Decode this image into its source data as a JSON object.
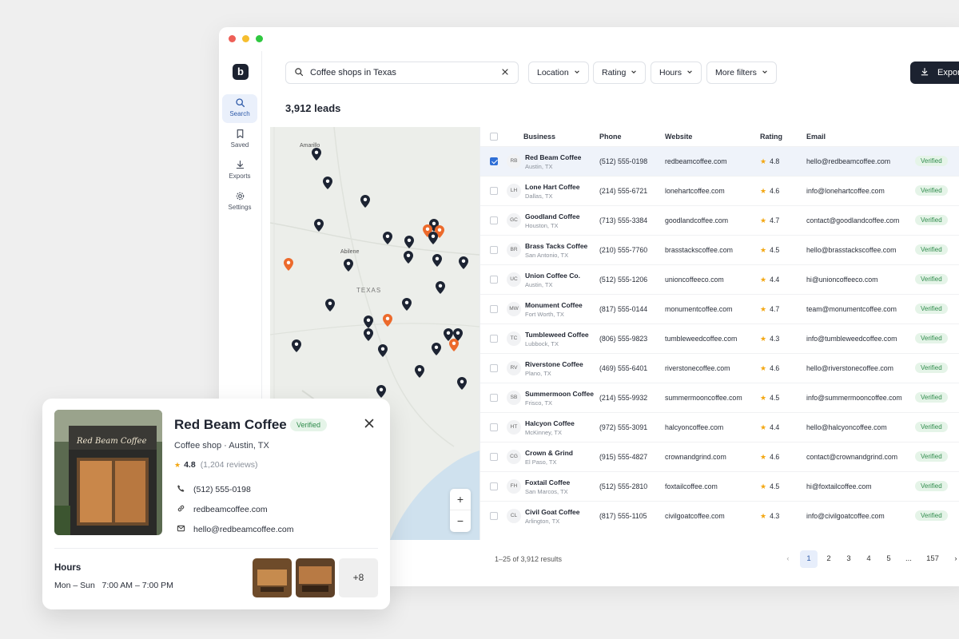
{
  "sidebar": {
    "logo": "b",
    "items": [
      {
        "label": "Search",
        "icon": "search-icon"
      },
      {
        "label": "Saved",
        "icon": "bookmark-icon"
      },
      {
        "label": "Exports",
        "icon": "download-icon"
      },
      {
        "label": "Settings",
        "icon": "gear-icon"
      }
    ]
  },
  "search": {
    "query": "Coffee shops in Texas"
  },
  "filters": [
    "Location",
    "Rating",
    "Hours",
    "More filters"
  ],
  "export_label": "Export",
  "leads_count": "3,912 leads",
  "map": {
    "labels": [
      "Amarillo",
      "Abilene",
      "TEXAS"
    ],
    "zoom_in": "+",
    "zoom_out": "−"
  },
  "table": {
    "headers": [
      "Business",
      "Phone",
      "Website",
      "Rating",
      "Email"
    ],
    "rows": [
      {
        "initials": "RB",
        "name": "Red Beam Coffee",
        "city": "Austin, TX",
        "phone": "(512) 555-0198",
        "website": "redbeamcoffee.com",
        "rating": "4.8",
        "email": "hello@redbeamcoffee.com",
        "status": "Verified",
        "selected": true
      },
      {
        "initials": "LH",
        "name": "Lone Hart Coffee",
        "city": "Dallas, TX",
        "phone": "(214) 555-6721",
        "website": "lonehartcoffee.com",
        "rating": "4.6",
        "email": "info@lonehartcoffee.com",
        "status": "Verified",
        "selected": false
      },
      {
        "initials": "GC",
        "name": "Goodland Coffee",
        "city": "Houston, TX",
        "phone": "(713) 555-3384",
        "website": "goodlandcoffee.com",
        "rating": "4.7",
        "email": "contact@goodlandcoffee.com",
        "status": "Verified",
        "selected": false
      },
      {
        "initials": "BR",
        "name": "Brass Tacks Coffee",
        "city": "San Antonio, TX",
        "phone": "(210) 555-7760",
        "website": "brasstackscoffee.com",
        "rating": "4.5",
        "email": "hello@brasstackscoffee.com",
        "status": "Verified",
        "selected": false
      },
      {
        "initials": "UC",
        "name": "Union Coffee Co.",
        "city": "Austin, TX",
        "phone": "(512) 555-1206",
        "website": "unioncoffeeco.com",
        "rating": "4.4",
        "email": "hi@unioncoffeeco.com",
        "status": "Verified",
        "selected": false
      },
      {
        "initials": "MW",
        "name": "Monument Coffee",
        "city": "Fort Worth, TX",
        "phone": "(817) 555-0144",
        "website": "monumentcoffee.com",
        "rating": "4.7",
        "email": "team@monumentcoffee.com",
        "status": "Verified",
        "selected": false
      },
      {
        "initials": "TC",
        "name": "Tumbleweed Coffee",
        "city": "Lubbock, TX",
        "phone": "(806) 555-9823",
        "website": "tumbleweedcoffee.com",
        "rating": "4.3",
        "email": "info@tumbleweedcoffee.com",
        "status": "Verified",
        "selected": false
      },
      {
        "initials": "RV",
        "name": "Riverstone Coffee",
        "city": "Plano, TX",
        "phone": "(469) 555-6401",
        "website": "riverstonecoffee.com",
        "rating": "4.6",
        "email": "hello@riverstonecoffee.com",
        "status": "Verified",
        "selected": false
      },
      {
        "initials": "SB",
        "name": "Summermoon Coffee",
        "city": "Frisco, TX",
        "phone": "(214) 555-9932",
        "website": "summermooncoffee.com",
        "rating": "4.5",
        "email": "info@summermooncoffee.com",
        "status": "Verified",
        "selected": false
      },
      {
        "initials": "HT",
        "name": "Halcyon Coffee",
        "city": "McKinney, TX",
        "phone": "(972) 555-3091",
        "website": "halcyoncoffee.com",
        "rating": "4.4",
        "email": "hello@halcyoncoffee.com",
        "status": "Verified",
        "selected": false
      },
      {
        "initials": "CG",
        "name": "Crown & Grind",
        "city": "El Paso, TX",
        "phone": "(915) 555-4827",
        "website": "crownandgrind.com",
        "rating": "4.6",
        "email": "contact@crownandgrind.com",
        "status": "Verified",
        "selected": false
      },
      {
        "initials": "FH",
        "name": "Foxtail Coffee",
        "city": "San Marcos, TX",
        "phone": "(512) 555-2810",
        "website": "foxtailcoffee.com",
        "rating": "4.5",
        "email": "hi@foxtailcoffee.com",
        "status": "Verified",
        "selected": false
      },
      {
        "initials": "CL",
        "name": "Civil Goat Coffee",
        "city": "Arlington, TX",
        "phone": "(817) 555-1105",
        "website": "civilgoatcoffee.com",
        "rating": "4.3",
        "email": "info@civilgoatcoffee.com",
        "status": "Verified",
        "selected": false
      }
    ]
  },
  "pagination": {
    "summary": "1–25 of 3,912 results",
    "prev": "‹",
    "pages": [
      "1",
      "2",
      "3",
      "4",
      "5",
      "...",
      "157"
    ],
    "next": "›",
    "current": "1"
  },
  "card": {
    "title": "Red Beam Coffee",
    "badge": "Verified",
    "subtitle": "Coffee shop · Austin, TX",
    "rating": "4.8",
    "reviews": "(1,204 reviews)",
    "phone": "(512) 555-0198",
    "website": "redbeamcoffee.com",
    "email": "hello@redbeamcoffee.com",
    "hours_title": "Hours",
    "hours_value": "Mon – Sun   7:00 AM – 7:00 PM",
    "photo_sign": "Red Beam Coffee",
    "more_photos": "+8"
  },
  "colors": {
    "accent": "#2f6fd6",
    "dark": "#1c2230",
    "verified_bg": "#e5f4e8",
    "verified_text": "#2f8b4b",
    "pin_dark": "#1d2433",
    "pin_orange": "#ec6a2c",
    "star": "#f3a712"
  }
}
